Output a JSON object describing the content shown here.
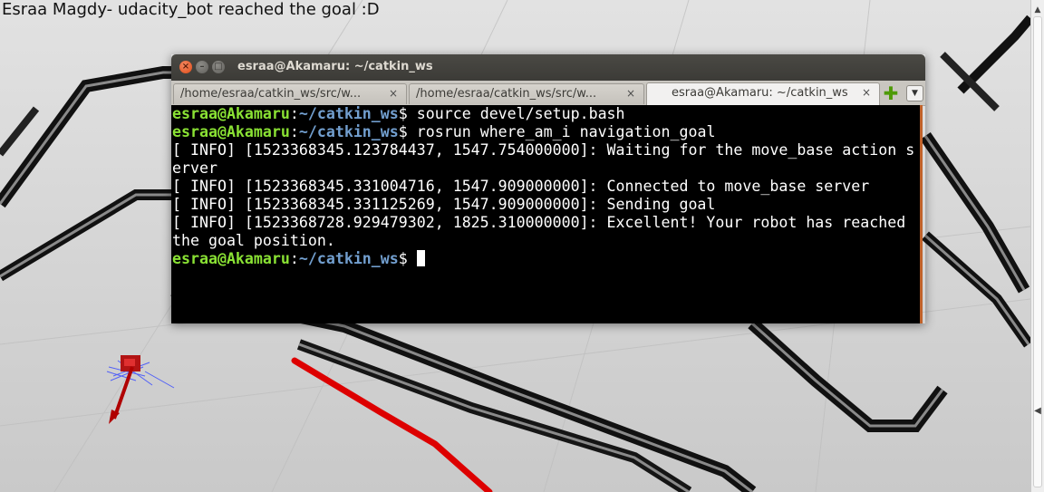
{
  "caption": "Esraa Magdy- udacity_bot reached the goal :D",
  "terminal": {
    "title": "esraa@Akamaru: ~/catkin_ws",
    "tabs": [
      {
        "label": "/home/esraa/catkin_ws/src/w...",
        "close": "×"
      },
      {
        "label": "/home/esraa/catkin_ws/src/w...",
        "close": "×"
      },
      {
        "label": "esraa@Akamaru: ~/catkin_ws",
        "close": "×",
        "active": true
      }
    ],
    "new_tab_icon": "plus-icon",
    "menu_icon": "chevron-down-icon",
    "prompt": {
      "user": "esraa@Akamaru",
      "colon": ":",
      "path": "~/catkin_ws",
      "dollar": "$ "
    },
    "commands": [
      "source devel/setup.bash",
      "rosrun where_am_i navigation_goal"
    ],
    "output": [
      "[ INFO] [1523368345.123784437, 1547.754000000]: Waiting for the move_base action s",
      "erver",
      "[ INFO] [1523368345.331004716, 1547.909000000]: Connected to move_base server",
      "[ INFO] [1523368345.331125269, 1547.909000000]: Sending goal",
      "[ INFO] [1523368728.929479302, 1825.310000000]: Excellent! Your robot has reached",
      "the goal position."
    ]
  },
  "colors": {
    "prompt_user": "#8ae234",
    "prompt_path": "#729fcf",
    "terminal_bg": "#000000",
    "titlebar": "#3c3b37",
    "close_button": "#df4a16",
    "path_line": "#dd0000"
  }
}
